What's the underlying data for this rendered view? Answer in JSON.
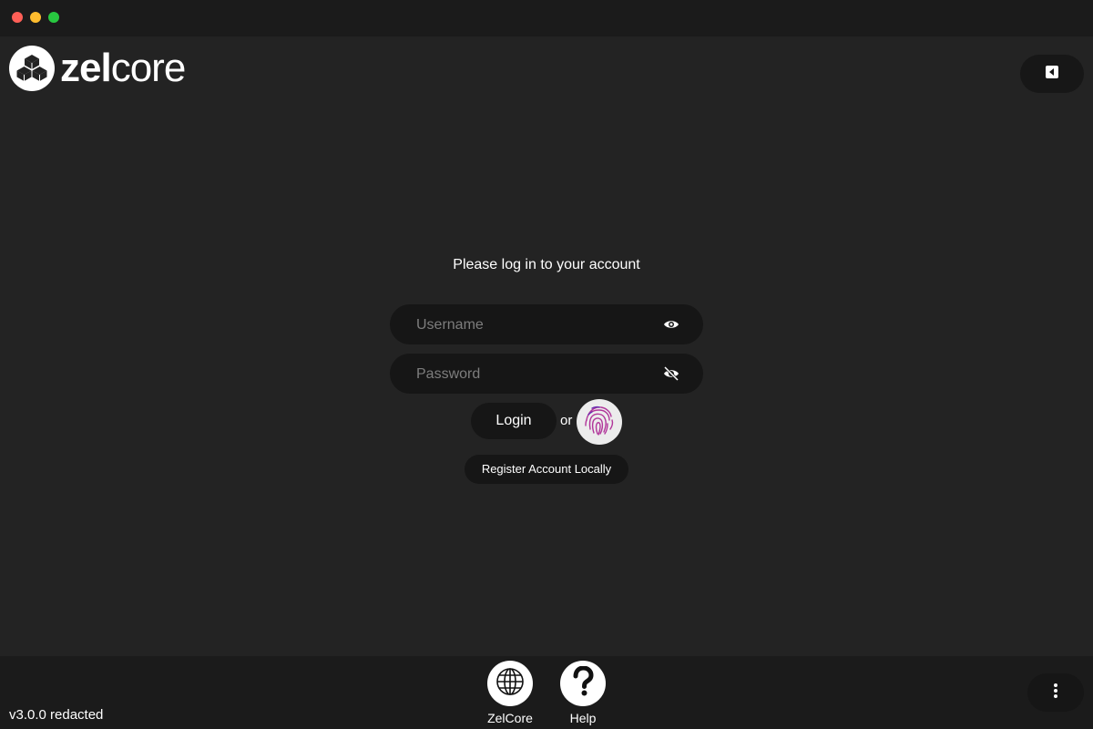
{
  "app": {
    "logo_text_bold": "zel",
    "logo_text_light": "core"
  },
  "login": {
    "prompt": "Please log in to your account",
    "username_placeholder": "Username",
    "password_placeholder": "Password",
    "login_label": "Login",
    "or_label": "or",
    "register_label": "Register Account Locally"
  },
  "footer": {
    "version": "v3.0.0 redacted",
    "zelcore_label": "ZelCore",
    "help_label": "Help"
  },
  "icons": {
    "logo": "zelcore-hex-logo-icon",
    "collapse": "caret-left-icon",
    "show_username": "eye-icon",
    "show_password": "eye-slash-icon",
    "fingerprint": "fingerprint-icon",
    "zelcore": "globe-icon",
    "help": "question-mark-icon",
    "menu": "vertical-dots-icon"
  },
  "colors": {
    "background": "#232323",
    "panel": "#1b1b1b",
    "button": "#161616",
    "fingerprint_accent": "#b1359a"
  }
}
